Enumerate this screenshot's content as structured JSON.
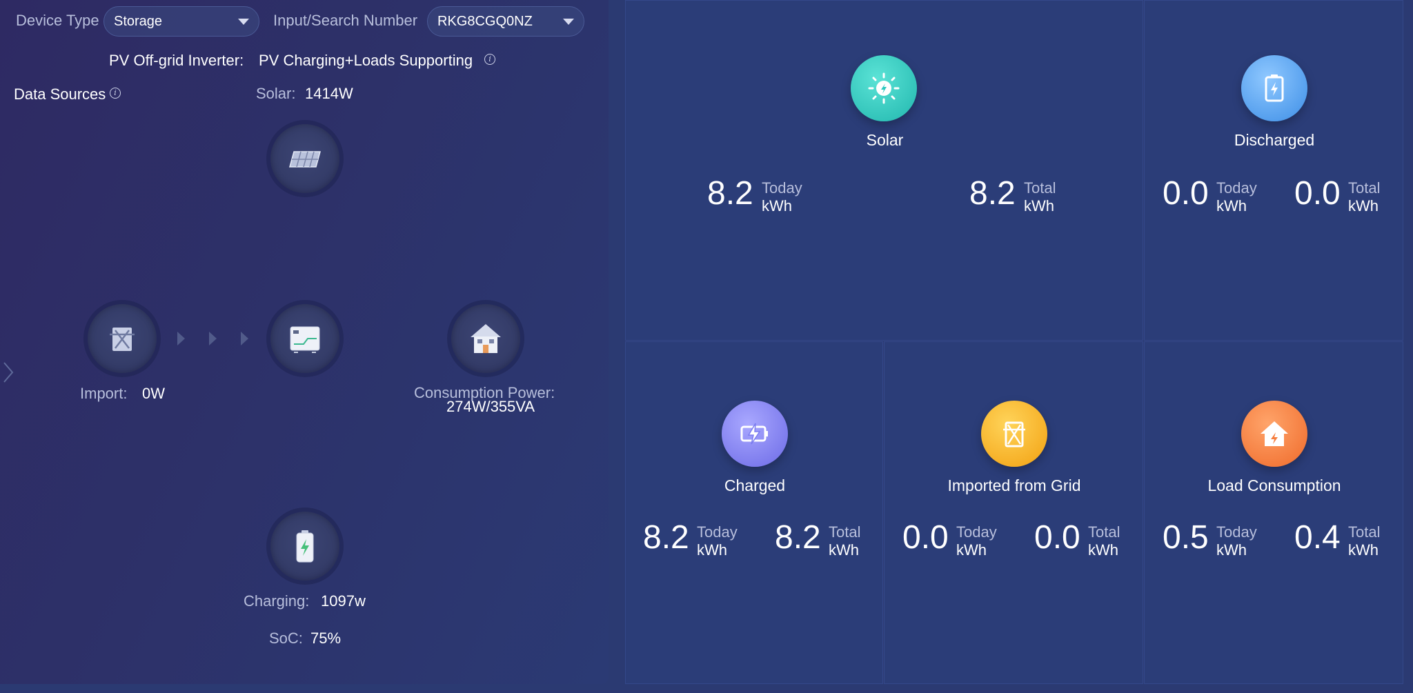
{
  "filters": {
    "device_type_label": "Device Type",
    "device_type_value": "Storage",
    "search_label": "Input/Search Number",
    "search_value": "RKG8CGQ0NZ"
  },
  "mode": {
    "label": "PV Off-grid Inverter:",
    "value": "PV Charging+Loads Supporting"
  },
  "data_sources_label": "Data Sources",
  "flow": {
    "solar_label": "Solar:",
    "solar_value": "1414W",
    "import_label": "Import:",
    "import_value": "0W",
    "consumption_label": "Consumption Power:",
    "consumption_value": "274W/355VA",
    "charging_label": "Charging:",
    "charging_value": "1097w",
    "soc_label": "SoC:",
    "soc_value": "75%"
  },
  "cards": {
    "solar": {
      "title": "Solar",
      "today_value": "8.2",
      "total_value": "8.2",
      "icon_color": "#2ec9c0"
    },
    "discharged": {
      "title": "Discharged",
      "today_value": "0.0",
      "total_value": "0.0",
      "icon_color": "#5aa8f2"
    },
    "charged": {
      "title": "Charged",
      "today_value": "8.2",
      "total_value": "8.2",
      "icon_color": "#7b7cf0"
    },
    "imported": {
      "title": "Imported from Grid",
      "today_value": "0.0",
      "total_value": "0.0",
      "icon_color": "#f8b21e"
    },
    "load": {
      "title": "Load Consumption",
      "today_value": "0.5",
      "total_value": "0.4",
      "icon_color": "#f67e3e"
    }
  },
  "units": {
    "today": "Today",
    "total": "Total",
    "kwh": "kWh"
  },
  "icons": {
    "solar_node": "solar-panel-icon",
    "grid_node": "grid-tower-icon",
    "inverter_node": "inverter-icon",
    "house_node": "house-icon",
    "battery_node": "battery-icon"
  }
}
